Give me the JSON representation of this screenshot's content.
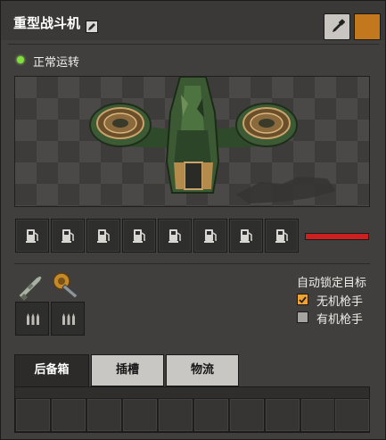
{
  "window": {
    "title": "重型战斗机",
    "icons": {
      "edit": "pencil-icon",
      "picker": "eyedropper-icon"
    },
    "color_swatch": "#c4781e"
  },
  "status": {
    "text": "正常运转",
    "color": "#7ee03a"
  },
  "preview": {
    "subject_icon": "heavy-fighter-aircraft-image"
  },
  "fuel": {
    "slot_icon": "fuel-pump-icon",
    "slot_count": 8,
    "energy_fill": 1.0,
    "energy_color": "#cc2020"
  },
  "weapons": {
    "items": [
      {
        "icon": "rifle-gun-icon"
      },
      {
        "icon": "cannon-turret-icon"
      }
    ],
    "ammo_icon": "ammo-bullets-icon"
  },
  "targeting": {
    "title": "自动锁定目标",
    "options": [
      {
        "label": "无机枪手",
        "checked": true
      },
      {
        "label": "有机枪手",
        "checked": false
      }
    ],
    "checked_color": "#f2a231"
  },
  "tabs": [
    {
      "label": "后备箱",
      "active": true
    },
    {
      "label": "插槽",
      "active": false
    },
    {
      "label": "物流",
      "active": false
    }
  ],
  "inventory": {
    "slot_count": 10
  }
}
